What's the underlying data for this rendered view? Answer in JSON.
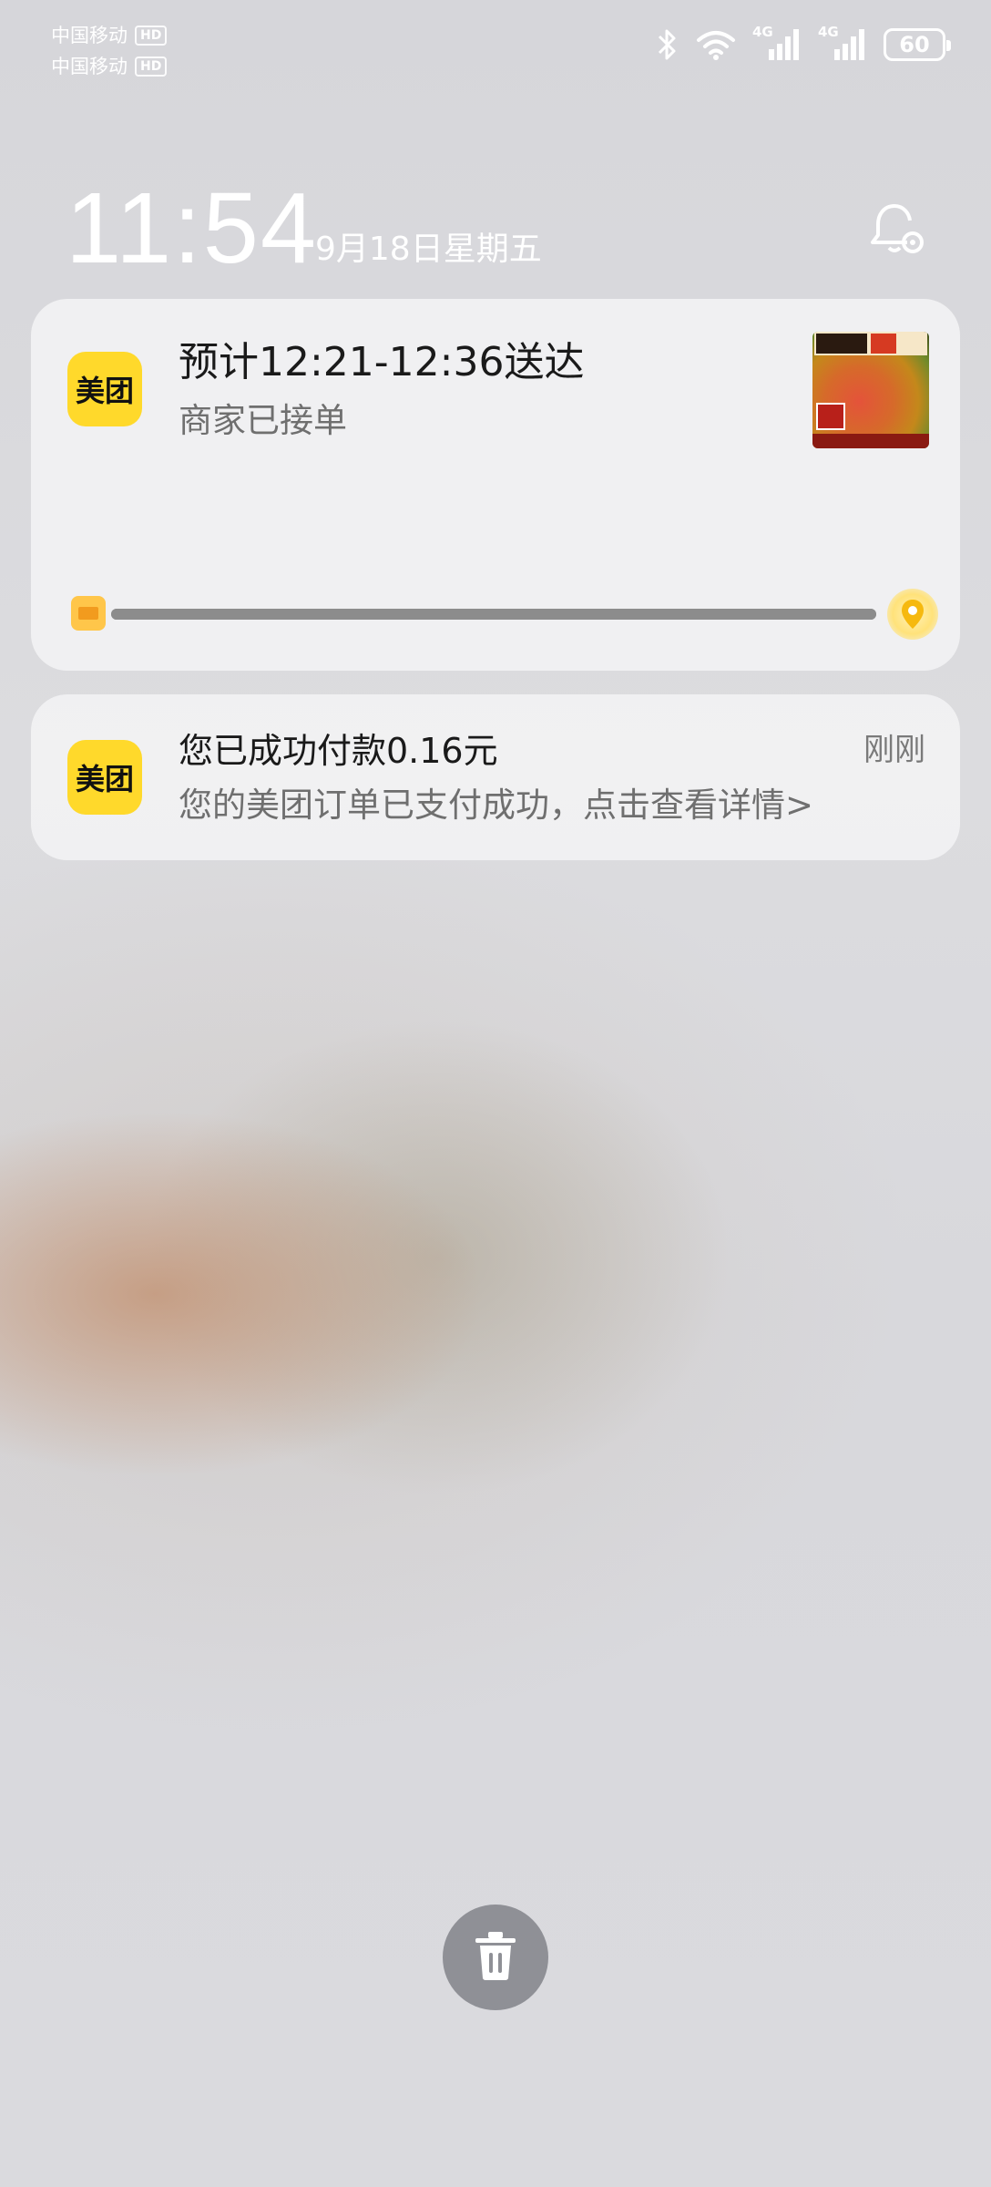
{
  "status_bar": {
    "carrier1": "中国移动",
    "carrier2": "中国移动",
    "hd_badge": "HD",
    "network1": "4G",
    "network2": "4G",
    "battery": "60"
  },
  "lockscreen": {
    "time": "11:54",
    "date": "9月18日星期五"
  },
  "notifications": [
    {
      "app_icon_text": "美团",
      "title": "预计12:21-12:36送达",
      "subtitle": "商家已接单",
      "delivery_progress": 1.0
    },
    {
      "app_icon_text": "美团",
      "title": "您已成功付款0.16元",
      "subtitle": "您的美团订单已支付成功，点击查看详情>",
      "time": "刚刚"
    }
  ],
  "colors": {
    "app_accent": "#ffd92b",
    "card_bg": "#f2f2f3",
    "trash_button": "#8f9096"
  },
  "icons": [
    "bluetooth-icon",
    "wifi-icon",
    "signal-icon",
    "battery-icon",
    "notification-settings-icon",
    "shop-icon",
    "location-pin-icon",
    "trash-icon"
  ]
}
